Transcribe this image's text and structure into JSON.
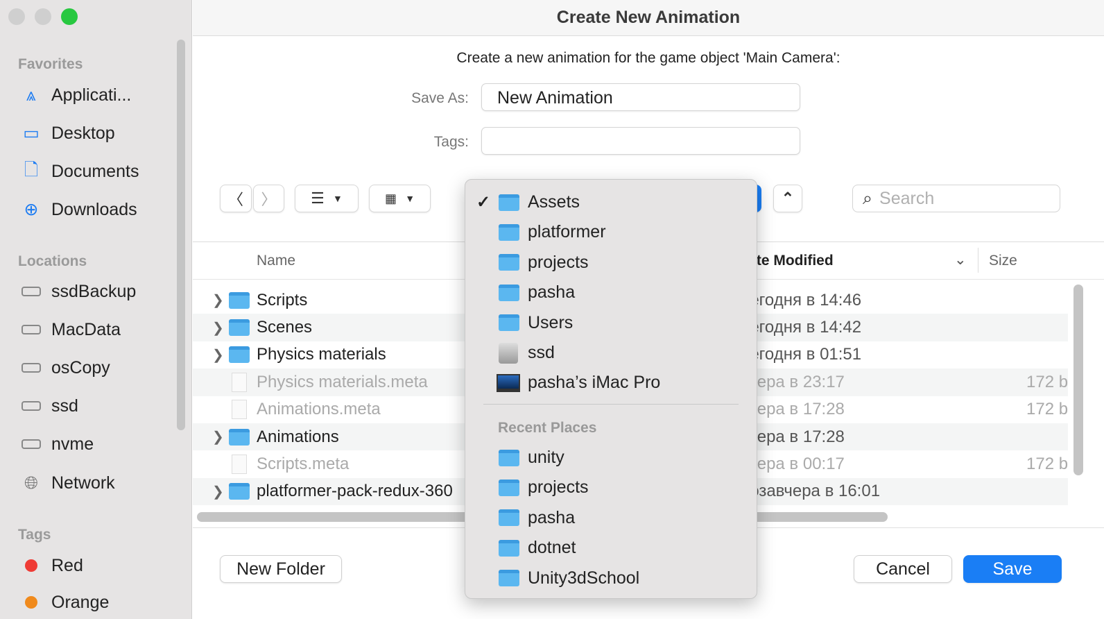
{
  "window": {
    "title": "Create New Animation"
  },
  "sidebar": {
    "favorites_label": "Favorites",
    "favorites": [
      {
        "label": "Applicati...",
        "icon": "applications-icon"
      },
      {
        "label": "Desktop",
        "icon": "desktop-icon"
      },
      {
        "label": "Documents",
        "icon": "document-icon"
      },
      {
        "label": "Downloads",
        "icon": "downloads-icon"
      }
    ],
    "locations_label": "Locations",
    "locations": [
      {
        "label": "ssdBackup"
      },
      {
        "label": "MacData"
      },
      {
        "label": "osCopy"
      },
      {
        "label": "ssd"
      },
      {
        "label": "nvme"
      },
      {
        "label": "Network"
      }
    ],
    "tags_label": "Tags",
    "tags": [
      {
        "label": "Red",
        "color": "#ef3b35"
      },
      {
        "label": "Orange",
        "color": "#f08a1c"
      }
    ]
  },
  "dialog": {
    "message": "Create a new animation for the game object 'Main Camera':",
    "save_as_label": "Save As:",
    "save_as_value": "New Animation",
    "tags_label": "Tags:",
    "tags_value": "",
    "search_placeholder": "Search"
  },
  "table": {
    "columns": {
      "name": "Name",
      "date": "Date Modified",
      "size": "Size"
    },
    "rows": [
      {
        "name": "Scripts",
        "date": "Сегодня в 14:46",
        "size": "",
        "kind": "folder"
      },
      {
        "name": "Scenes",
        "date": "Сегодня в 14:42",
        "size": "",
        "kind": "folder"
      },
      {
        "name": "Physics materials",
        "date": "Сегодня в 01:51",
        "size": "",
        "kind": "folder"
      },
      {
        "name": "Physics materials.meta",
        "date": "Вчера в 23:17",
        "size": "172 b",
        "kind": "file"
      },
      {
        "name": "Animations.meta",
        "date": "Вчера в 17:28",
        "size": "172 b",
        "kind": "file"
      },
      {
        "name": "Animations",
        "date": "Вчера в 17:28",
        "size": "",
        "kind": "folder"
      },
      {
        "name": "Scripts.meta",
        "date": "Вчера в 00:17",
        "size": "172 b",
        "kind": "file"
      },
      {
        "name": "platformer-pack-redux-360",
        "date": "Позавчера в 16:01",
        "size": "",
        "kind": "folder"
      }
    ]
  },
  "popup": {
    "selected": "Assets",
    "path": [
      "Assets",
      "platformer",
      "projects",
      "pasha",
      "Users",
      "ssd",
      "pasha’s iMac Pro"
    ],
    "recent_label": "Recent Places",
    "recent": [
      "unity",
      "projects",
      "pasha",
      "dotnet",
      "Unity3dSchool"
    ]
  },
  "buttons": {
    "new_folder": "New Folder",
    "cancel": "Cancel",
    "save": "Save"
  },
  "colors": {
    "accent": "#1a7ef5"
  }
}
